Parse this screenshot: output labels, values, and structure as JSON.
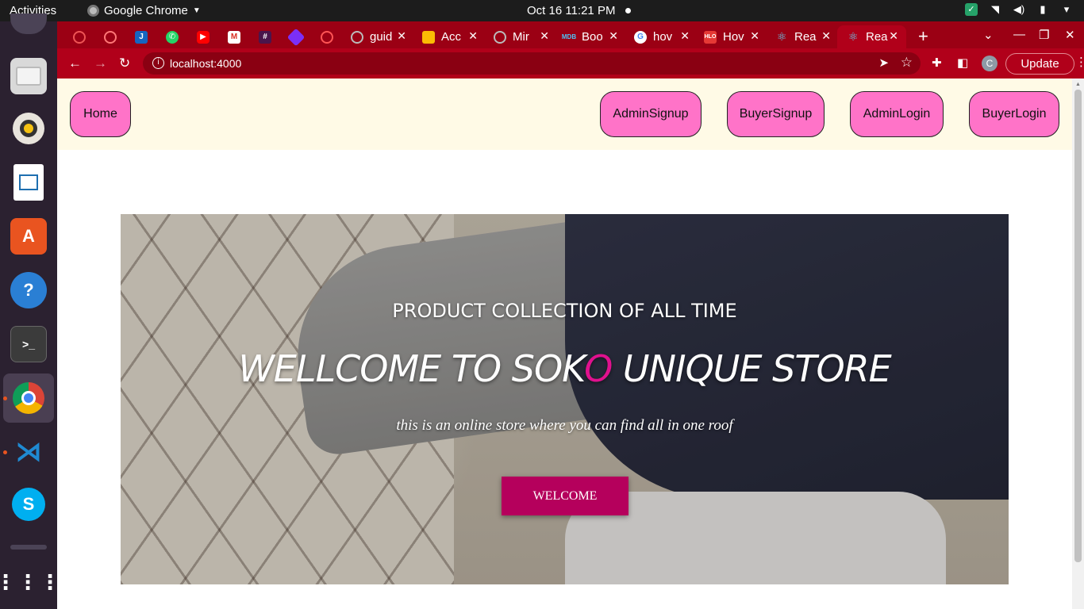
{
  "system": {
    "activities": "Activities",
    "app_name": "Google Chrome",
    "clock": "Oct 16  11:21 PM"
  },
  "dock": {
    "items": [
      "ubuntu-icon",
      "files-icon",
      "rhythmbox-icon",
      "writer-icon",
      "software-icon",
      "help-icon",
      "terminal-icon",
      "chrome-icon",
      "vscode-icon",
      "skype-icon",
      "apps-grid-icon"
    ]
  },
  "browser": {
    "tabs": [
      {
        "label": "guid"
      },
      {
        "label": "Acc"
      },
      {
        "label": "Mir"
      },
      {
        "label": "Boo"
      },
      {
        "label": "hov"
      },
      {
        "label": "Hov"
      },
      {
        "label": "Rea"
      },
      {
        "label": "Rea"
      }
    ],
    "pinned_icons": [
      "github-icon",
      "redux-icon",
      "json-icon",
      "whatsapp-icon",
      "youtube-icon",
      "gmail-icon",
      "slack-icon",
      "vsite-icon",
      "globe-icon"
    ],
    "url": "localhost:4000",
    "update_label": "Update",
    "profile_initial": "C"
  },
  "page": {
    "nav": {
      "home": "Home",
      "admin_signup": "AdminSignup",
      "buyer_signup": "BuyerSignup",
      "admin_login": "AdminLogin",
      "buyer_login": "BuyerLogin"
    },
    "hero": {
      "subtitle": "PRODUCT COLLECTION OF ALL TIME",
      "headline_before": "WELLCOME TO SOK",
      "headline_accent": "O",
      "headline_after": " UNIQUE STORE",
      "tagline": "this is an online store where you can find all in one roof",
      "button": "WELCOME"
    }
  },
  "colors": {
    "nav_bg": "#fffae6",
    "nav_button": "#ff73c8",
    "accent_o": "#e0118e",
    "welcome_button": "#b5005c",
    "chrome_theme": "#b1001a"
  }
}
